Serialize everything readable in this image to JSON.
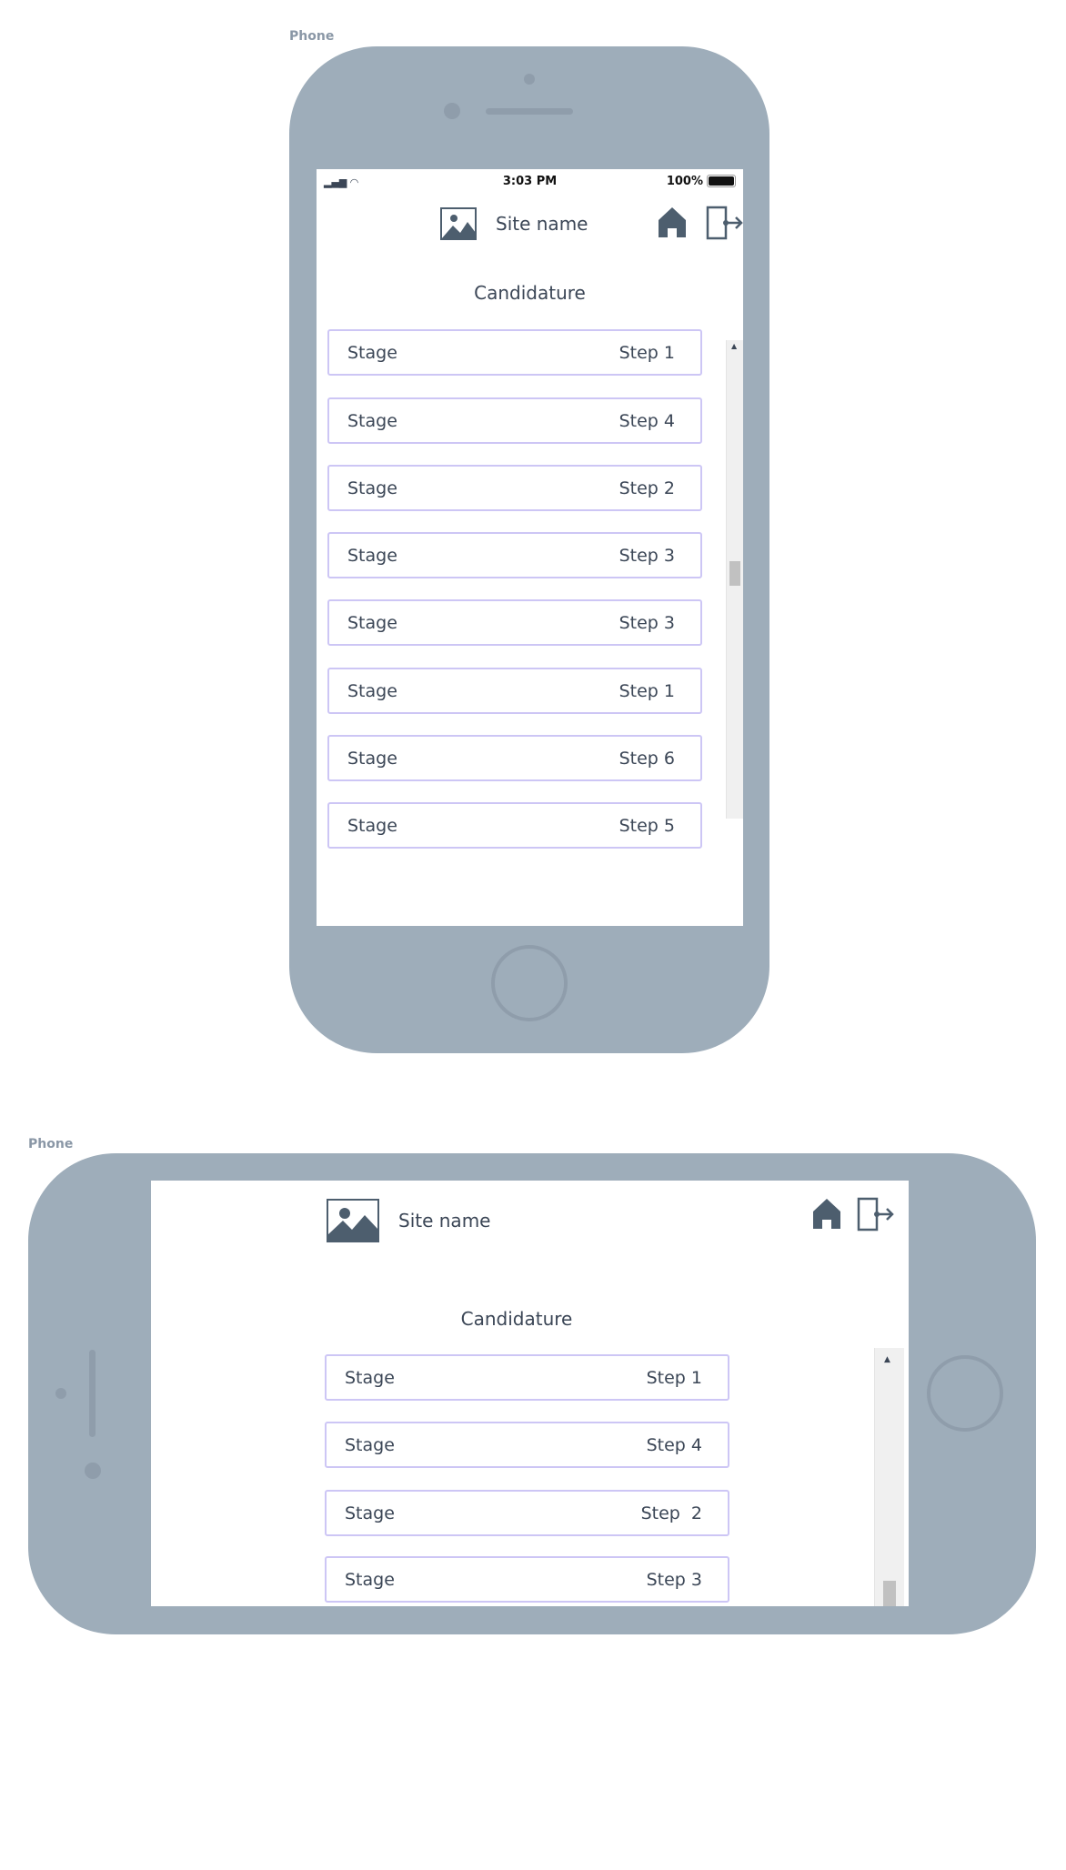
{
  "portrait": {
    "label": "Phone",
    "status": {
      "time": "3:03 PM",
      "battery": "100%"
    },
    "header": {
      "site_name": "Site name"
    },
    "title": "Candidature",
    "items": [
      {
        "stage": "Stage",
        "step": "Step 1"
      },
      {
        "stage": "Stage",
        "step": "Step 4"
      },
      {
        "stage": "Stage",
        "step": "Step 2"
      },
      {
        "stage": "Stage",
        "step": "Step 3"
      },
      {
        "stage": "Stage",
        "step": "Step 3"
      },
      {
        "stage": "Stage",
        "step": "Step 1"
      },
      {
        "stage": "Stage",
        "step": "Step 6"
      },
      {
        "stage": "Stage",
        "step": "Step 5"
      }
    ]
  },
  "landscape": {
    "label": "Phone",
    "header": {
      "site_name": "Site name"
    },
    "title": "Candidature",
    "items": [
      {
        "stage": "Stage",
        "step": "Step 1"
      },
      {
        "stage": "Stage",
        "step": "Step 4"
      },
      {
        "stage": "Stage",
        "step": "Step  2"
      },
      {
        "stage": "Stage",
        "step": "Step 3"
      }
    ]
  },
  "colors": {
    "device": "#9eadba",
    "item_border": "#cdc6f5",
    "text": "#3b4656",
    "icon": "#4d5e6e"
  }
}
